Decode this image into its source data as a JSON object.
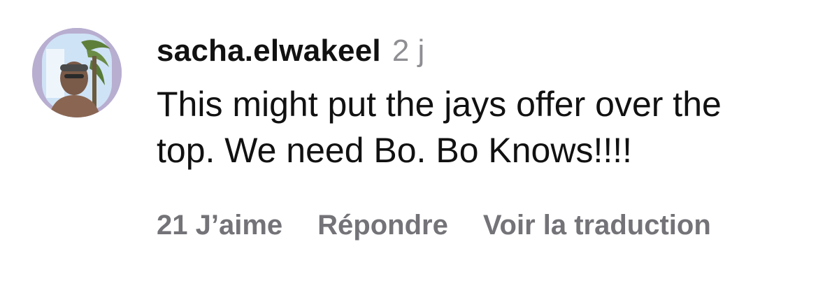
{
  "comment": {
    "username": "sacha.elwakeel",
    "timestamp": "2 j",
    "text": "This might put the jays offer over the top. We need Bo. Bo Knows!!!!",
    "likes_label": "21 J’aime",
    "reply_label": "Répondre",
    "translate_label": "Voir la traduction"
  },
  "colors": {
    "text_primary": "#111111",
    "text_secondary": "#8e8e93",
    "action_text": "#737378",
    "background": "#ffffff"
  }
}
